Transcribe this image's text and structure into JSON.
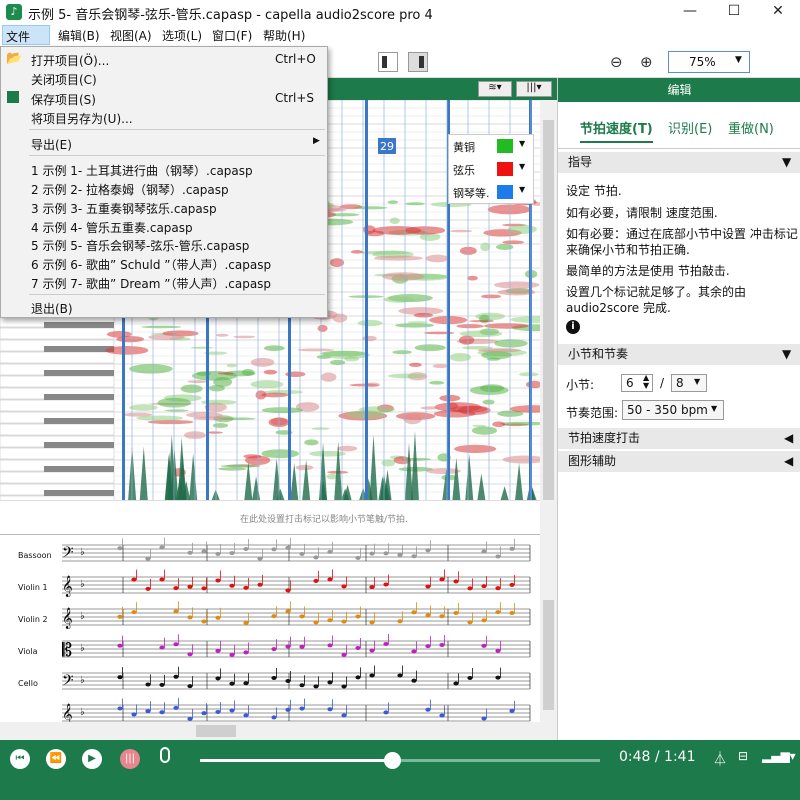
{
  "window": {
    "title": "示例 5- 音乐会钢琴-弦乐-管乐.capasp  - capella audio2score pro 4"
  },
  "menu": {
    "items": [
      "文件(D)",
      "编辑(B)",
      "视图(A)",
      "选项(L)",
      "窗口(F)",
      "帮助(H)"
    ]
  },
  "file_menu": {
    "open": "打开项目(Ö)...",
    "open_shortcut": "Ctrl+O",
    "close": "关闭项目(C)",
    "save": "保存项目(S)",
    "save_shortcut": "Ctrl+S",
    "save_as": "将项目另存为(U)...",
    "export": "导出(E)",
    "recent": [
      "1 示例 1- 土耳其进行曲（钢琴）.capasp",
      "2 示例 2- 拉格泰姆（钢琴）.capasp",
      "3 示例 3- 五重奏钢琴弦乐.capasp",
      "4 示例 4- 管乐五重奏.capasp",
      "5 示例 5- 音乐会钢琴-弦乐-管乐.capasp",
      "6 示例 6- 歌曲” Schuld ”（带人声）.capasp",
      "7 示例 7- 歌曲” Dream ”（带人声）.capasp"
    ],
    "exit": "退出(B)"
  },
  "zoom": {
    "value": "75%"
  },
  "spectrogram": {
    "measure_marker": "29",
    "hint": "在此处设置打击标记以影响小节笔触/节拍."
  },
  "legend": [
    {
      "label": "黄铜",
      "color": "#22bb22"
    },
    {
      "label": "弦乐",
      "color": "#ee1111"
    },
    {
      "label": "钢琴等.",
      "color": "#1e7bea"
    }
  ],
  "score": {
    "instruments": [
      "Bassoon",
      "Violin 1",
      "Violin 2",
      "Viola",
      "Cello"
    ]
  },
  "panel": {
    "header": "编辑",
    "tabs": [
      "节拍速度(T)",
      "识别(E)",
      "重做(N)"
    ],
    "guide_title": "指导",
    "guide_lines": [
      "设定 节拍.",
      "如有必要，请限制 速度范围.",
      "如有必要：通过在底部小节中设置 冲击标记",
      "来确保小节和节拍正确.",
      "最简单的方法是使用 节拍敲击.",
      "设置几个标记就足够了。其余的由",
      "audio2score 完成."
    ],
    "measure_title": "小节和节奏",
    "measure_label": "小节:",
    "numerator": "6",
    "slash": "/",
    "denominator": "8",
    "tempo_label": "节奏范围:",
    "tempo_value": "50 - 350 bpm",
    "tap_title": "节拍速度打击",
    "graphic_title": "图形辅助"
  },
  "player": {
    "time": "0:48 / 1:41",
    "progress": 0.48
  }
}
